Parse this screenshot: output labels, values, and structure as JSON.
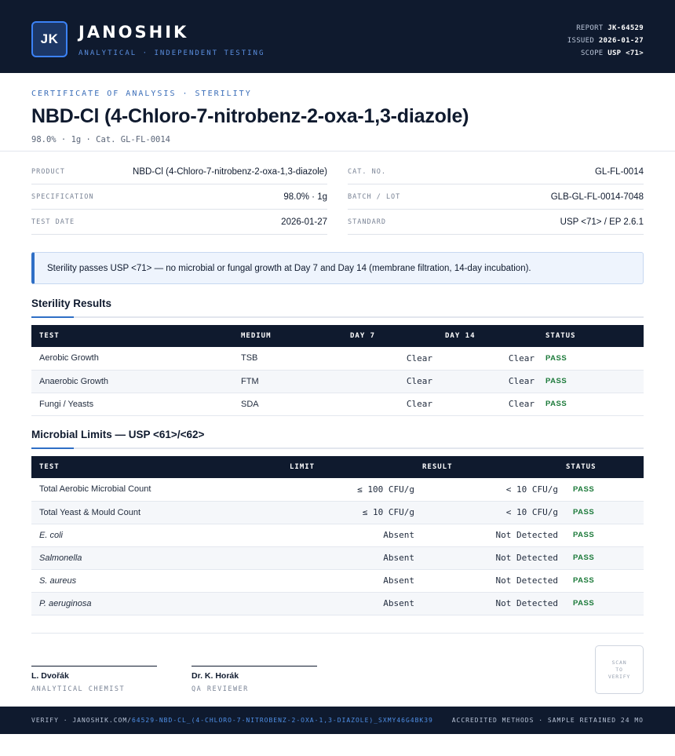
{
  "header": {
    "logo": "JK",
    "brand": "JANOSHIK",
    "tagline": "ANALYTICAL · INDEPENDENT TESTING",
    "report_label": "REPORT",
    "report_value": "JK-64529",
    "issued_label": "ISSUED",
    "issued_value": "2026-01-27",
    "scope_label": "SCOPE",
    "scope_value": "USP <71>"
  },
  "doc": {
    "kicker": "CERTIFICATE OF ANALYSIS · STERILITY",
    "title": "NBD-Cl (4-Chloro-7-nitrobenz-2-oxa-1,3-diazole)",
    "subtitle": "98.0% · 1g  ·  Cat. GL-FL-0014"
  },
  "info": {
    "left": [
      {
        "label": "PRODUCT",
        "value": "NBD-Cl (4-Chloro-7-nitrobenz-2-oxa-1,3-diazole)"
      },
      {
        "label": "SPECIFICATION",
        "value": "98.0% · 1g"
      },
      {
        "label": "TEST DATE",
        "value": "2026-01-27"
      }
    ],
    "right": [
      {
        "label": "CAT. NO.",
        "value": "GL-FL-0014"
      },
      {
        "label": "BATCH / LOT",
        "value": "GLB-GL-FL-0014-7048"
      },
      {
        "label": "STANDARD",
        "value": "USP <71> / EP 2.6.1"
      }
    ]
  },
  "notice": "Sterility passes USP <71> — no microbial or fungal growth at Day 7 and Day 14 (membrane filtration, 14-day incubation).",
  "sterility": {
    "title": "Sterility Results",
    "headers": [
      "TEST",
      "MEDIUM",
      "DAY 7",
      "DAY 14",
      "STATUS"
    ],
    "rows": [
      {
        "test": "Aerobic Growth",
        "medium": "TSB",
        "day7": "Clear",
        "day14": "Clear",
        "status": "PASS"
      },
      {
        "test": "Anaerobic Growth",
        "medium": "FTM",
        "day7": "Clear",
        "day14": "Clear",
        "status": "PASS"
      },
      {
        "test": "Fungi / Yeasts",
        "medium": "SDA",
        "day7": "Clear",
        "day14": "Clear",
        "status": "PASS"
      }
    ]
  },
  "limits": {
    "title": "Microbial Limits — USP <61>/<62>",
    "headers": [
      "TEST",
      "LIMIT",
      "RESULT",
      "STATUS"
    ],
    "rows": [
      {
        "test": "Total Aerobic Microbial Count",
        "limit": "≤ 100 CFU/g",
        "result": "< 10 CFU/g",
        "status": "PASS"
      },
      {
        "test": "Total Yeast & Mould Count",
        "limit": "≤ 10 CFU/g",
        "result": "< 10 CFU/g",
        "status": "PASS"
      },
      {
        "test": "E. coli",
        "limit": "Absent",
        "result": "Not Detected",
        "status": "PASS"
      },
      {
        "test": "Salmonella",
        "limit": "Absent",
        "result": "Not Detected",
        "status": "PASS"
      },
      {
        "test": "S. aureus",
        "limit": "Absent",
        "result": "Not Detected",
        "status": "PASS"
      },
      {
        "test": "P. aeruginosa",
        "limit": "Absent",
        "result": "Not Detected",
        "status": "PASS"
      }
    ]
  },
  "signatures": [
    {
      "name": "L. Dvořák",
      "role": "ANALYTICAL CHEMIST"
    },
    {
      "name": "Dr. K. Horák",
      "role": "QA REVIEWER"
    }
  ],
  "qr_text": [
    "SCAN",
    "TO",
    "VERIFY"
  ],
  "footer": {
    "prefix": "VERIFY · JANOSHIK.COM/",
    "url": "64529-NBD-CL_(4-CHLORO-7-NITROBENZ-2-OXA-1,3-DIAZOLE)_SXMY46G4BK39",
    "right": "ACCREDITED METHODS · SAMPLE RETAINED 24 MO"
  },
  "colors": {
    "navy": "#0f1a2e",
    "accent": "#2f6fc6",
    "pass": "#1c7a3a"
  }
}
